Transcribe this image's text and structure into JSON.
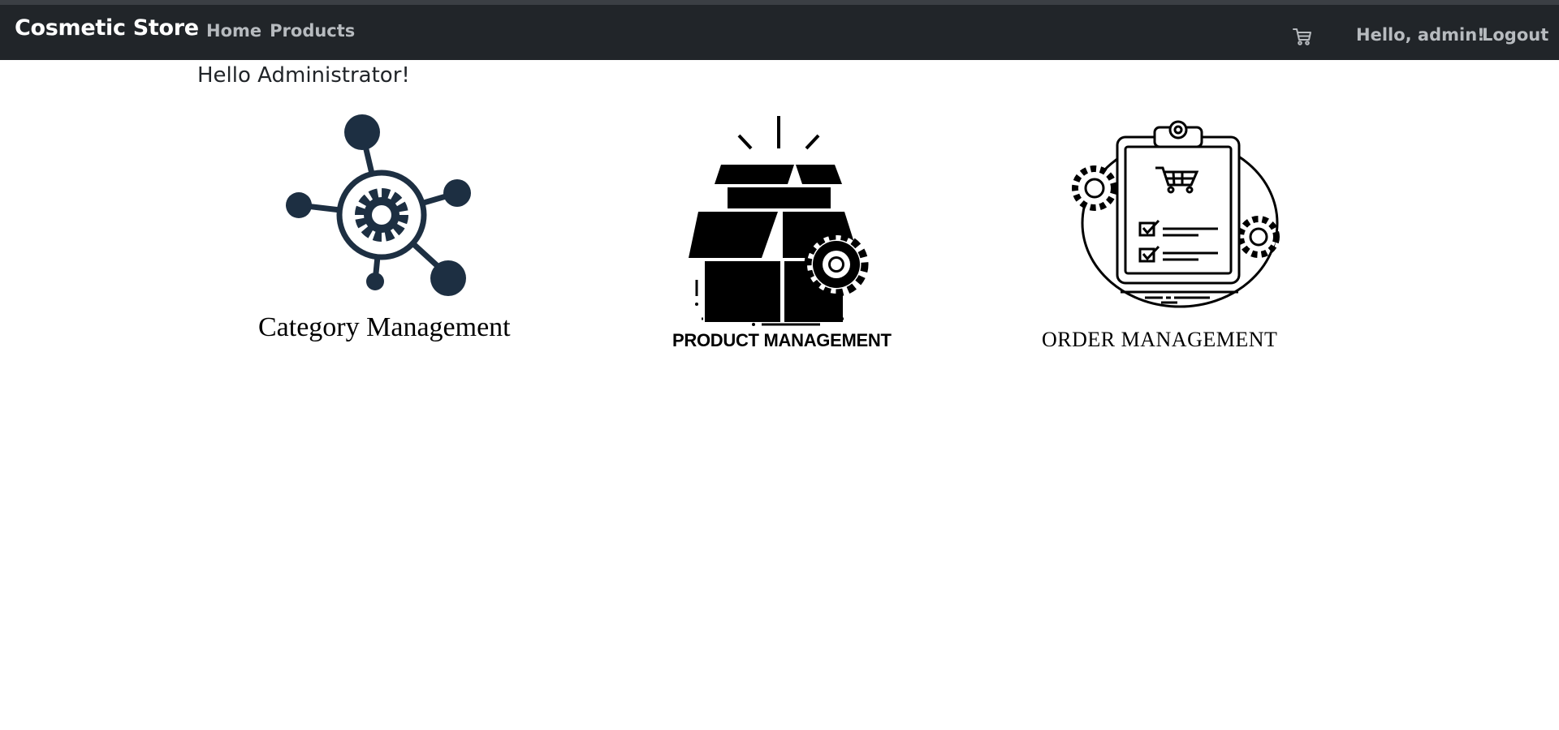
{
  "navbar": {
    "brand": "Cosmetic Store",
    "links": [
      {
        "label": "Home"
      },
      {
        "label": "Products"
      }
    ],
    "cart_icon": "cart-icon",
    "user_greeting": "Hello, admin!",
    "logout_label": "Logout"
  },
  "main": {
    "greeting": "Hello Administrator!",
    "cards": [
      {
        "label": "Category Management",
        "icon": "network-gear-icon",
        "color": "#1d2f42"
      },
      {
        "label": "PRODUCT MANAGEMENT",
        "icon": "box-gear-icon",
        "color": "#000000"
      },
      {
        "label": "ORDER MANAGEMENT",
        "icon": "clipboard-cart-icon",
        "color": "#000000"
      }
    ]
  },
  "colors": {
    "navbar_bg": "#212529",
    "nav_link": "#b7bbbf",
    "brand": "#ffffff"
  }
}
